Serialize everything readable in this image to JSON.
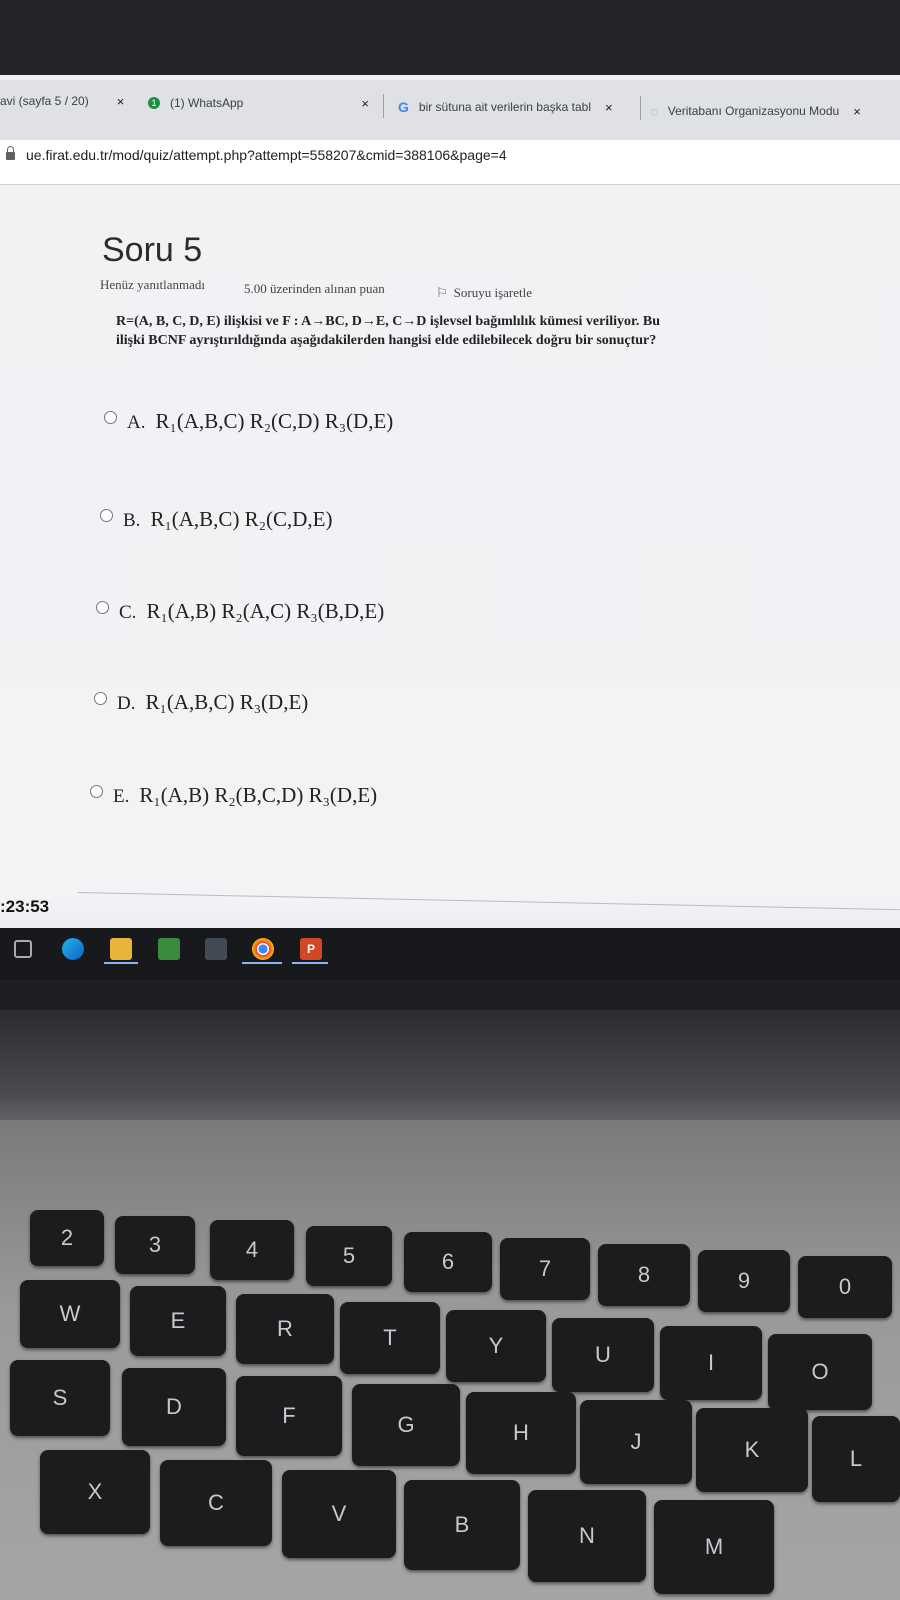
{
  "browser": {
    "tabs": [
      {
        "label": "avi (sayfa 5 / 20)",
        "close": "×"
      },
      {
        "label": "(1) WhatsApp",
        "badge": "1",
        "close": "×"
      },
      {
        "label": "bir sütuna ait verilerin başka tabl",
        "icon_letter": "G",
        "close": "×"
      },
      {
        "label": "Veritabanı Organizasyonu Modu",
        "close": "×"
      }
    ],
    "url": "ue.firat.edu.tr/mod/quiz/attempt.php?attempt=558207&cmid=388106&page=4"
  },
  "quiz": {
    "title": "Soru 5",
    "status": "Henüz yanıtlanmadı",
    "points": "5.00 üzerinden alınan puan",
    "flag": "Soruyu işaretle",
    "question_line1": "R=(A, B, C, D, E) ilişkisi ve F : A→BC, D→E, C→D işlevsel bağımlılık kümesi veriliyor. Bu",
    "question_line2": "ilişki BCNF ayrıştırıldığında aşağıdakilerden hangisi elde edilebilecek doğru bir sonuçtur?",
    "options": [
      {
        "letter": "A.",
        "text": "R₁(A,B,C) R₂(C,D) R₃(D,E)"
      },
      {
        "letter": "B.",
        "text": "R₁(A,B,C) R₂(C,D,E)"
      },
      {
        "letter": "C.",
        "text": "R₁(A,B) R₂(A,C) R₃(B,D,E)"
      },
      {
        "letter": "D.",
        "text": "R₁(A,B,C) R₃(D,E)"
      },
      {
        "letter": "E.",
        "text": "R₁(A,B) R₂(B,C,D) R₃(D,E)"
      }
    ]
  },
  "system": {
    "clock": ":23:53",
    "taskbar_icons": [
      "task-view-icon",
      "edge-icon",
      "file-explorer-icon",
      "store-icon",
      "app-icon",
      "chrome-icon",
      "powerpoint-icon"
    ]
  },
  "keyboard": {
    "keys": [
      "2",
      "3",
      "4",
      "5",
      "6",
      "7",
      "8",
      "9",
      "0",
      "W",
      "E",
      "R",
      "T",
      "Y",
      "U",
      "I",
      "O",
      "S",
      "D",
      "F",
      "G",
      "H",
      "J",
      "K",
      "L",
      "X",
      "C",
      "V",
      "B",
      "N",
      "M"
    ]
  }
}
